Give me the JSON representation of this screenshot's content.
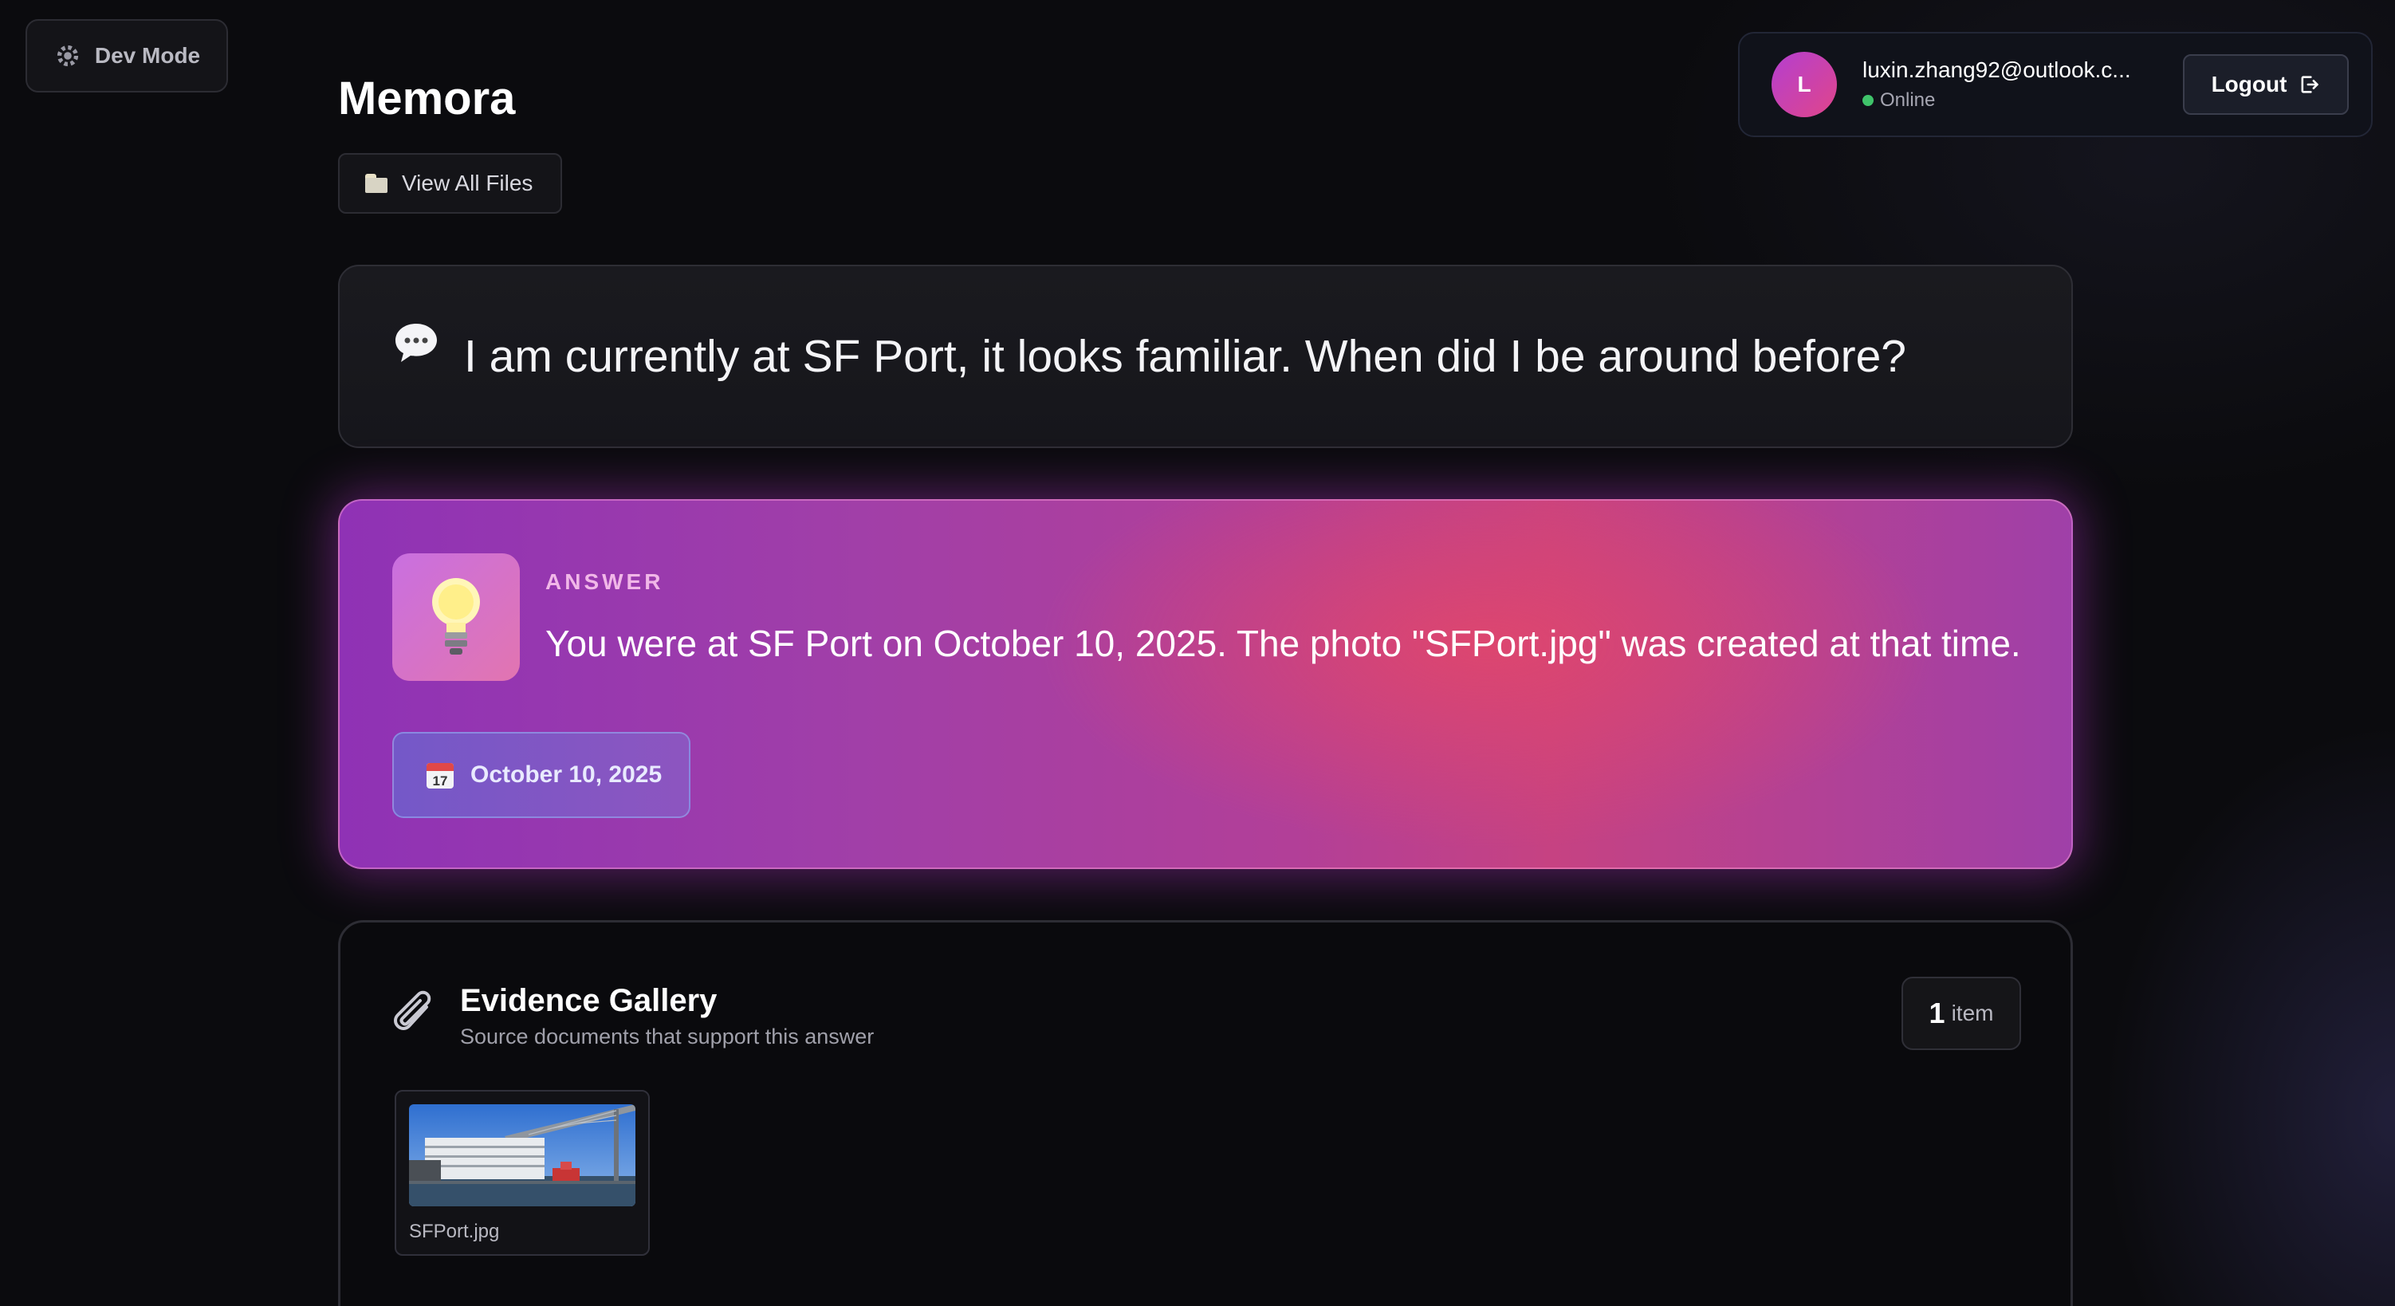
{
  "dev_mode": {
    "label": "Dev Mode",
    "icon": "gear-icon"
  },
  "app": {
    "title": "Memora"
  },
  "files_button": {
    "label": "View All Files",
    "icon": "folder-icon"
  },
  "user": {
    "avatar_initial": "L",
    "email": "luxin.zhang92@outlook.c...",
    "status": "Online",
    "status_color": "#3fc36a",
    "logout_label": "Logout"
  },
  "question": {
    "icon": "speech-bubble-icon",
    "text": "I am currently at SF Port, it looks familiar. When did I be around before?"
  },
  "answer": {
    "icon": "lightbulb-icon",
    "label": "ANSWER",
    "text": "You were at SF Port on October 10, 2025. The photo \"SFPort.jpg\" was created at that time.",
    "date_icon": "calendar-icon",
    "date": "October 10, 2025"
  },
  "gallery": {
    "icon": "paperclip-icon",
    "title": "Evidence Gallery",
    "subtitle": "Source documents that support this answer",
    "count": "1",
    "count_unit": "item",
    "items": [
      {
        "name": "SFPort.jpg"
      }
    ]
  },
  "colors": {
    "background": "#0b0b0e",
    "answer_gradient_start": "#8f32b5",
    "answer_gradient_end": "#c64282",
    "accent": "#e0458a"
  }
}
